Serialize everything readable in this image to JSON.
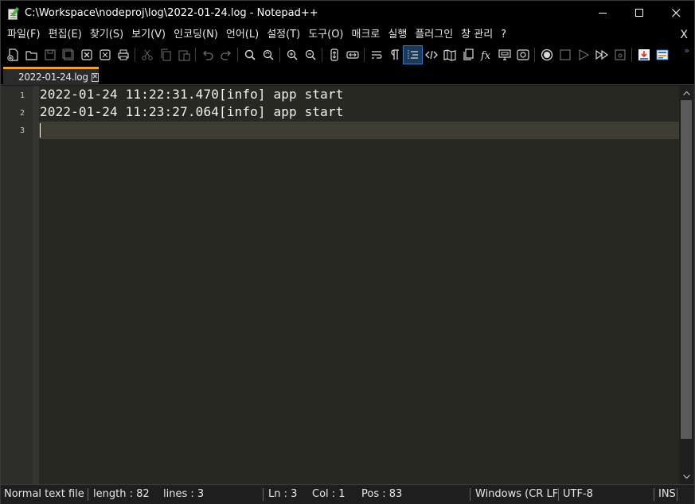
{
  "window": {
    "title": "C:\\Workspace\\nodeproj\\log\\2022-01-24.log - Notepad++",
    "controls": {
      "minimize": "minimize",
      "maximize": "maximize",
      "close": "close"
    }
  },
  "menubar": {
    "items": [
      "파일(F)",
      "편집(E)",
      "찾기(S)",
      "보기(V)",
      "인코딩(N)",
      "언어(L)",
      "설정(T)",
      "도구(O)",
      "매크로",
      "실행",
      "플러그인",
      "창 관리",
      "?"
    ],
    "close_label": "X"
  },
  "toolbar": {
    "icons": [
      "new-file",
      "open-file",
      "save",
      "save-all",
      "close",
      "close-all",
      "print",
      "cut",
      "copy",
      "paste",
      "undo",
      "redo",
      "find",
      "replace",
      "zoom-in",
      "zoom-out",
      "sync-vertical",
      "sync-horizontal",
      "word-wrap",
      "show-all-chars",
      "indent-guide",
      "xml-tags",
      "doc-map",
      "doc-list",
      "function-list",
      "monitor",
      "spy-glass",
      "macro-record",
      "macro-stop",
      "macro-play",
      "macro-run-multiple",
      "macro-save",
      "plugin-1",
      "plugin-2"
    ],
    "active_icon": "indent-guide",
    "more_label": "»"
  },
  "tabs": [
    {
      "label": "2022-01-24.log",
      "active": true,
      "accent": "#f0a030"
    }
  ],
  "editor": {
    "lines": [
      {
        "number": "1",
        "text": "2022-01-24 11:22:31.470[info] app start"
      },
      {
        "number": "2",
        "text": "2022-01-24 11:23:27.064[info] app start"
      },
      {
        "number": "3",
        "text": ""
      }
    ],
    "background": "#272822",
    "current_line_color": "#3e3d32"
  },
  "statusbar": {
    "file_type": "Normal text file",
    "length": "length : 82",
    "lines": "lines : 3",
    "ln": "Ln : 3",
    "col": "Col : 1",
    "pos": "Pos : 83",
    "eol": "Windows (CR LF)",
    "encoding": "UTF-8",
    "mode": "INS"
  }
}
